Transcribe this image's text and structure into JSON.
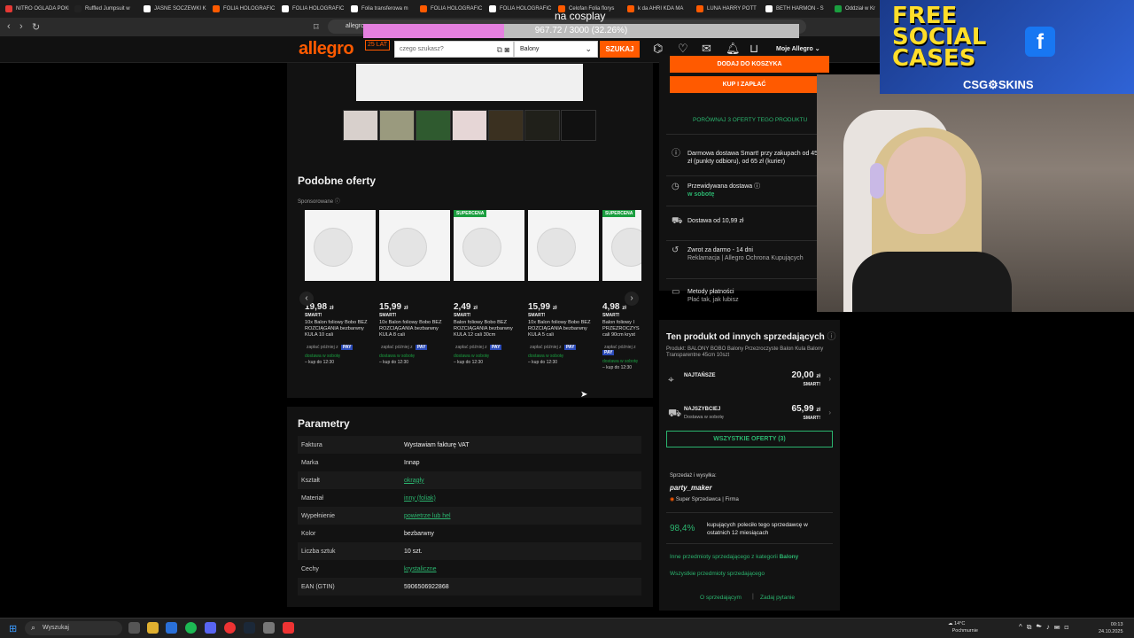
{
  "browser": {
    "tabs": [
      {
        "label": "NITRO OGLADA POKE",
        "color": "#e53935"
      },
      {
        "label": "Ruffled Jumpsuit w",
        "color": "#222"
      },
      {
        "label": "JASNE SOCZEWKI K",
        "color": "#ffffff"
      },
      {
        "label": "FOLIA HOLOGRAFIC",
        "color": "#ff5a00"
      },
      {
        "label": "FOLIA HOLOGRAFIC",
        "color": "#ffffff"
      },
      {
        "label": "Folia transferowa m",
        "color": "#ffffff"
      },
      {
        "label": "FOLIA HOLOGRAFIC",
        "color": "#ff5a00"
      },
      {
        "label": "FOLIA HOLOGRAFIC",
        "color": "#ffffff"
      },
      {
        "label": "Celofan Folia florys",
        "color": "#ff5a00"
      },
      {
        "label": "k da AHRI KDA MA",
        "color": "#ff5a00"
      },
      {
        "label": "LUNA HARRY POTT",
        "color": "#ff5a00"
      },
      {
        "label": "BETH HARMON - S",
        "color": "#ffffff"
      },
      {
        "label": "Oddział w Kr",
        "color": "#1a9e3f"
      }
    ],
    "url": "allegro"
  },
  "overlay": {
    "title": "na cosplay",
    "progress_text": "967.72 / 3000 (32.26%)",
    "progress_fraction": 0.3226
  },
  "header": {
    "logo": "allegro",
    "logo_badge": "25 LAT",
    "search_placeholder": "czego szukasz?",
    "category": "Balony",
    "search_button": "SZUKAJ",
    "my_allegro": "Moje Allegro"
  },
  "left": {
    "similar_title": "Podobne oferty",
    "sponsored": "Sponsorowane",
    "products": [
      {
        "badge": "",
        "price": "19,98",
        "title": "10x Balon foliowy Bobo BEZ ROZCIĄGANIA bezbarwny KULA 10 cali",
        "pay": "zapłać później z",
        "deliv": "dostawa w sobotę",
        "buy": "– kup do 12:30"
      },
      {
        "badge": "",
        "price": "15,99",
        "title": "10x Balon foliowy Bobo BEZ ROZCIĄGANIA bezbarwny KULA 8 cali",
        "pay": "zapłać później z",
        "deliv": "dostawa w sobotę",
        "buy": "– kup do 12:30"
      },
      {
        "badge": "SUPERCENA",
        "price": "2,49",
        "title": "Balon foliowy Bobo BEZ ROZCIĄGANIA bezbarwny KULA 12 cali 30cm",
        "pay": "zapłać później z",
        "deliv": "dostawa w sobotę",
        "buy": "– kup do 12:30"
      },
      {
        "badge": "",
        "price": "15,99",
        "title": "10x Balon foliowy Bobo BEZ ROZCIĄGANIA bezbarwny KULA 5 cali",
        "pay": "zapłać później z",
        "deliv": "dostawa w sobotę",
        "buy": "– kup do 12:30"
      },
      {
        "badge": "SUPERCENA",
        "price": "4,98",
        "title": "Balon foliowy I PRZEZROCZYS cali 90cm kryst",
        "pay": "zapłać później z",
        "deliv": "dostawa w sobotę",
        "buy": "– kup do 12:30"
      }
    ],
    "currency": "zł",
    "smart": "SMART!",
    "pay_badge": "PAY",
    "params_title": "Parametry",
    "params": [
      {
        "k": "Faktura",
        "v": "Wystawiam fakturę VAT",
        "link": false
      },
      {
        "k": "Marka",
        "v": "Innap",
        "link": false
      },
      {
        "k": "Kształt",
        "v": "okrągły",
        "link": true
      },
      {
        "k": "Materiał",
        "v": "inny (foliak)",
        "link": true
      },
      {
        "k": "Wypełnienie",
        "v": "powietrze lub hel",
        "link": true
      },
      {
        "k": "Kolor",
        "v": "bezbarwny",
        "link": false
      },
      {
        "k": "Liczba sztuk",
        "v": "10 szt.",
        "link": false
      },
      {
        "k": "Cechy",
        "v": "krystaliczne",
        "link": true
      },
      {
        "k": "EAN (GTIN)",
        "v": "5906506922868",
        "link": false
      }
    ]
  },
  "right": {
    "add_to_cart": "DODAJ DO KOSZYKA",
    "buy_now": "KUP I ZAPŁAĆ",
    "compare": "PORÓWNAJ 3 OFERTY TEGO PRODUKTU",
    "info": [
      {
        "icon": "info-icon",
        "text": "Darmowa dostawa Smart! przy zakupach od 45 zł (punkty odbioru), od 65 zł (kurier)",
        "sub": ""
      },
      {
        "icon": "clock-icon",
        "text": "Przewidywana dostawa ⓘ",
        "sub": "w sobotę"
      },
      {
        "icon": "truck-icon",
        "text": "Dostawa od 10,99 zł",
        "sub": ""
      },
      {
        "icon": "return-icon",
        "text": "Zwrot za darmo - 14 dni",
        "sub": "Reklamacja | Allegro Ochrona Kupujących"
      },
      {
        "icon": "card-icon",
        "text": "Metody płatności",
        "sub": "Płać tak, jak lubisz"
      }
    ],
    "others_title": "Ten produkt od innych sprzedających",
    "others_sub": "Produkt: BALONY BOBO Balony Przezroczyste Balon Kula Balony Transparentne 45cm 10szt",
    "offers": [
      {
        "label": "NAJTAŃSZE",
        "sub": "",
        "price": "20,00"
      },
      {
        "label": "NAJSZYBCIEJ",
        "sub": "Dostawa w sobotę",
        "price": "65,99"
      }
    ],
    "all_offers": "WSZYSTKIE OFERTY (3)",
    "seller_label": "Sprzedaż i wysyłka:",
    "seller_name": "party_maker",
    "seller_badge": "Super Sprzedawca | Firma",
    "rating": "98,4%",
    "rating_text": "kupujących poleciło tego sprzedawcę w ostatnich 12 miesiącach",
    "more_cat": "Inne przedmioty sprzedającego z kategorii",
    "more_cat_bold": "Balony",
    "all_items": "Wszystkie przedmioty sprzedającego",
    "about_seller": "O sprzedającym",
    "ask": "Zadaj pytanie"
  },
  "ad": {
    "line1": "FREE",
    "line2": "SOCIAL",
    "line3": "CASES",
    "brand": "CSG⚙SKINS",
    "fb": "f"
  },
  "taskbar": {
    "search": "Wyszukaj",
    "temp": "14°C",
    "weather": "Pochmurnie",
    "time": "00:13",
    "date": "24.10.2025"
  }
}
